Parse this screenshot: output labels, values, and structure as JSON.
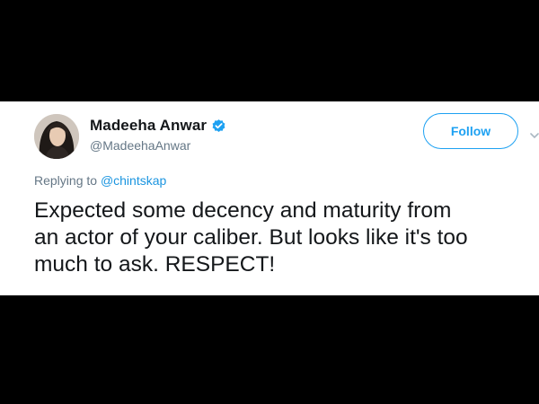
{
  "tweet": {
    "author": {
      "name": "Madeeha Anwar",
      "handle": "@MadeehaAnwar",
      "avatar_icon": "profile-photo",
      "verified_icon": "verified-badge-icon"
    },
    "follow_label": "Follow",
    "reply": {
      "prefix": "Replying to",
      "target": "@chintskap"
    },
    "text_lines": [
      "Expected some decency and maturity from",
      "an actor of your caliber. But looks like it's too",
      "much to ask. RESPECT!"
    ]
  },
  "colors": {
    "background": "#000000",
    "card": "#ffffff",
    "accent": "#1da1f2",
    "link": "#1b95e0",
    "secondary_text": "#657786",
    "primary_text": "#14171a"
  }
}
